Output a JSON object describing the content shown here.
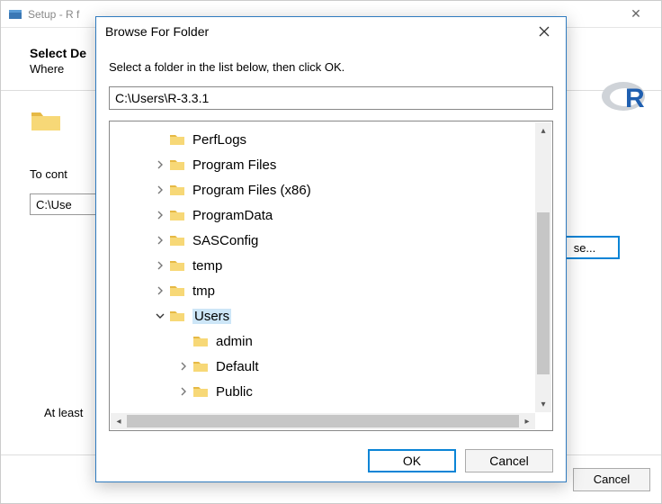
{
  "installer": {
    "title": "Setup - R f",
    "heading": "Select De",
    "subheading": "Where",
    "continue_text": "To cont",
    "path_value": "C:\\Use",
    "browse_label": "se...",
    "atleast_text": "At least",
    "cancel_label": "Cancel"
  },
  "dialog": {
    "title": "Browse For Folder",
    "instruction": "Select a folder in the list below, then click OK.",
    "path_value": "C:\\Users\\R-3.3.1",
    "ok_label": "OK",
    "cancel_label": "Cancel",
    "tree": [
      {
        "label": "PerfLogs",
        "expander": "",
        "indent": 0,
        "selected": false
      },
      {
        "label": "Program Files",
        "expander": ">",
        "indent": 0,
        "selected": false
      },
      {
        "label": "Program Files (x86)",
        "expander": ">",
        "indent": 0,
        "selected": false
      },
      {
        "label": "ProgramData",
        "expander": ">",
        "indent": 0,
        "selected": false
      },
      {
        "label": "SASConfig",
        "expander": ">",
        "indent": 0,
        "selected": false
      },
      {
        "label": "temp",
        "expander": ">",
        "indent": 0,
        "selected": false
      },
      {
        "label": "tmp",
        "expander": ">",
        "indent": 0,
        "selected": false
      },
      {
        "label": "Users",
        "expander": "v",
        "indent": 0,
        "selected": true
      },
      {
        "label": "admin",
        "expander": "",
        "indent": 1,
        "selected": false
      },
      {
        "label": "Default",
        "expander": ">",
        "indent": 1,
        "selected": false
      },
      {
        "label": "Public",
        "expander": ">",
        "indent": 1,
        "selected": false
      }
    ]
  }
}
